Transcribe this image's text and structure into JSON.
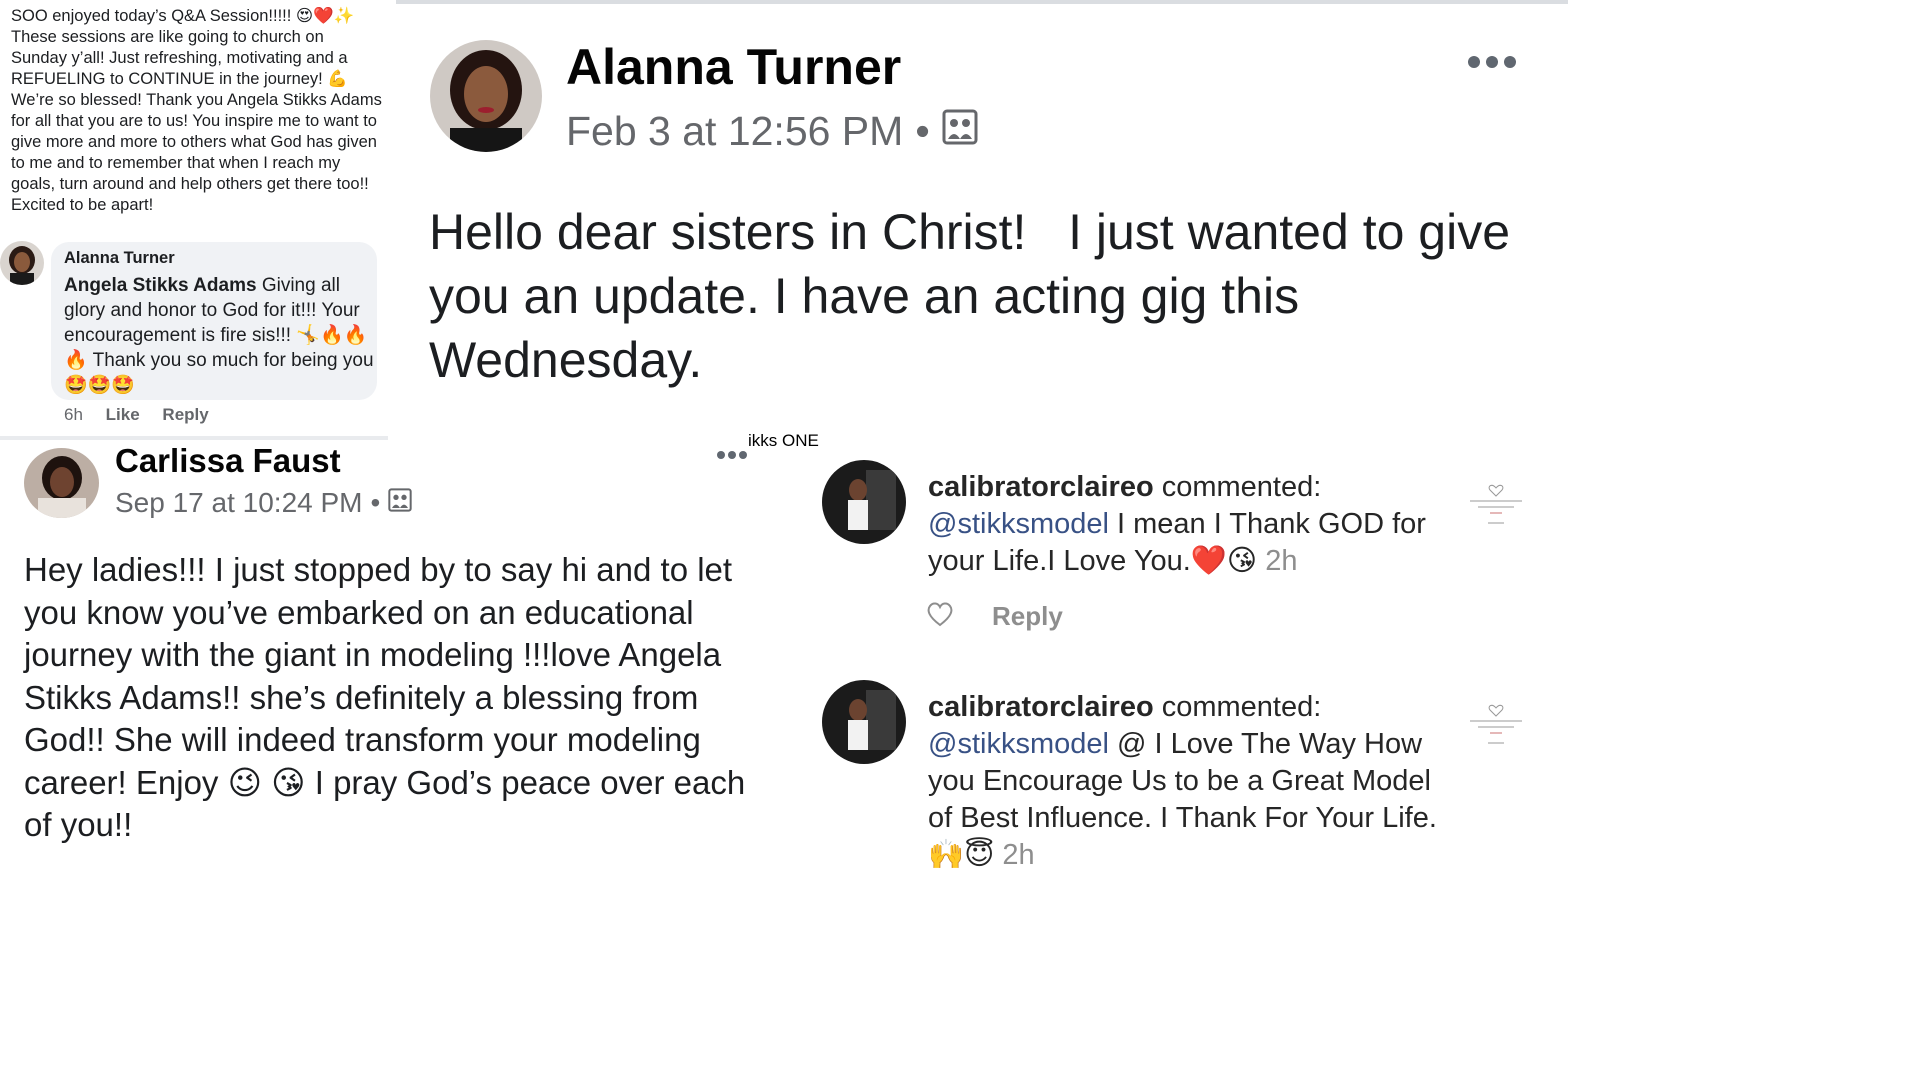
{
  "panel1": {
    "post_text": "SOO enjoyed today’s Q&A Session!!!!! 😍❤️✨ These sessions are like going to church on Sunday y’all! Just refreshing, motivating and a REFUELING to CONTINUE in the journey! 💪 We’re so blessed! Thank you Angela Stikks Adams for all that you are to us! You inspire me to want to give more and more to others what God has given to me and to remember that when I reach my goals, turn around and help others get there too!! Excited to be apart!",
    "reply": {
      "author": "Alanna Turner",
      "mention": "Angela Stikks Adams",
      "text": " Giving all glory and honor to God for it!!! Your encouragement is fire sis!!! 🤸🔥🔥🔥 Thank you so much for being you🤩🤩🤩",
      "time": "6h",
      "like_label": "Like",
      "reply_label": "Reply"
    }
  },
  "panel2": {
    "author": "Alanna Turner",
    "timestamp": "Feb 3 at 12:56 PM",
    "separator": "•",
    "privacy_icon": "group-icon",
    "body": "Hello dear sisters in Christ!   I just wanted to give you an update. I have an acting gig this Wednesday."
  },
  "panel3": {
    "author": "Carlissa Faust",
    "timestamp": "Sep 17 at 10:24 PM",
    "separator": "•",
    "privacy_icon": "group-icon",
    "fragment": "ikks ONE",
    "body": "Hey ladies!!! I just stopped by to say hi and to let you know you’ve embarked on an educational journey with the giant in modeling !!!love Angela Stikks Adams!!  she’s definitely a blessing from God!! She will indeed transform your modeling career! Enjoy 😉 😘 I pray God’s peace over each of you!!"
  },
  "panel4": {
    "username": "calibratorclaireo",
    "action": " commented:",
    "mention": "@stikksmodel",
    "text": " I mean I Thank GOD for your Life.I Love You.❤️😘 ",
    "time": "2h",
    "reply_label": "Reply"
  },
  "panel5": {
    "username": "calibratorclaireo",
    "action": " commented:",
    "mention": "@stikksmodel",
    "text": " @ I Love The Way How you Encourage Us to be a Great Model of Best Influence. I Thank For Your Life. 🙌😇 ",
    "time": "2h"
  },
  "colors": {
    "fb_secondary": "#65676b",
    "bubble": "#f0f2f5",
    "ig_mention": "#385185",
    "ig_secondary": "#8e8e8e"
  }
}
